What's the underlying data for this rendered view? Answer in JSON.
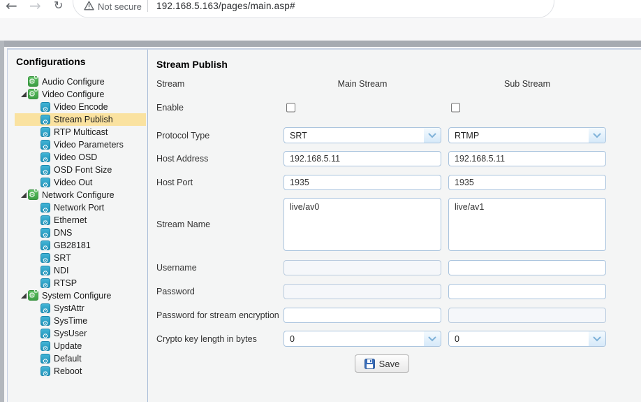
{
  "browser": {
    "back_icon": "left-arrow",
    "forward_icon": "right-arrow",
    "refresh_icon": "reload",
    "security_icon": "warning-triangle",
    "security_label": "Not secure",
    "url": "192.168.5.163/pages/main.asp#"
  },
  "sidebar": {
    "title": "Configurations",
    "items": [
      {
        "label": "Audio Configure",
        "level": 0,
        "type": "group"
      },
      {
        "label": "Video Configure",
        "level": 0,
        "type": "group",
        "expanded": true
      },
      {
        "label": "Video Encode",
        "level": 1
      },
      {
        "label": "Stream Publish",
        "level": 1,
        "selected": true
      },
      {
        "label": "RTP Multicast",
        "level": 1
      },
      {
        "label": "Video Parameters",
        "level": 1
      },
      {
        "label": "Video OSD",
        "level": 1
      },
      {
        "label": "OSD Font Size",
        "level": 1
      },
      {
        "label": "Video Out",
        "level": 1
      },
      {
        "label": "Network Configure",
        "level": 0,
        "type": "group",
        "expanded": true
      },
      {
        "label": "Network Port",
        "level": 1
      },
      {
        "label": "Ethernet",
        "level": 1
      },
      {
        "label": "DNS",
        "level": 1
      },
      {
        "label": "GB28181",
        "level": 1
      },
      {
        "label": "SRT",
        "level": 1
      },
      {
        "label": "NDI",
        "level": 1
      },
      {
        "label": "RTSP",
        "level": 1
      },
      {
        "label": "System Configure",
        "level": 0,
        "type": "group",
        "expanded": true
      },
      {
        "label": "SystAttr",
        "level": 1
      },
      {
        "label": "SysTime",
        "level": 1
      },
      {
        "label": "SysUser",
        "level": 1
      },
      {
        "label": "Update",
        "level": 1
      },
      {
        "label": "Default",
        "level": 1
      },
      {
        "label": "Reboot",
        "level": 1
      }
    ]
  },
  "form": {
    "title": "Stream Publish",
    "header": {
      "stream": "Stream",
      "main": "Main Stream",
      "sub": "Sub Stream"
    },
    "enable": {
      "label": "Enable",
      "main_checked": false,
      "sub_checked": false
    },
    "protocol_type": {
      "label": "Protocol Type",
      "main": "SRT",
      "sub": "RTMP"
    },
    "host_address": {
      "label": "Host Address",
      "main": "192.168.5.11",
      "sub": "192.168.5.11"
    },
    "host_port": {
      "label": "Host Port",
      "main": "1935",
      "sub": "1935"
    },
    "stream_name": {
      "label": "Stream Name",
      "main": "live/av0",
      "sub": "live/av1"
    },
    "username": {
      "label": "Username",
      "main": "",
      "sub": "",
      "main_disabled": true
    },
    "password": {
      "label": "Password",
      "main": "",
      "sub": "",
      "main_disabled": true
    },
    "password_encryption": {
      "label": "Password for stream encryption",
      "main": "",
      "sub": "",
      "sub_disabled": true
    },
    "crypto_key_length": {
      "label": "Crypto key length in bytes",
      "main": "0",
      "sub": "0"
    },
    "save_label": "Save"
  },
  "colors": {
    "selected_highlight": "#fae2a0",
    "group_icon_green": "#46a74c",
    "item_icon_blue": "#2aa3c9",
    "field_border_blue": "#aac4de",
    "top_bar_gray": "#a6aab1"
  }
}
